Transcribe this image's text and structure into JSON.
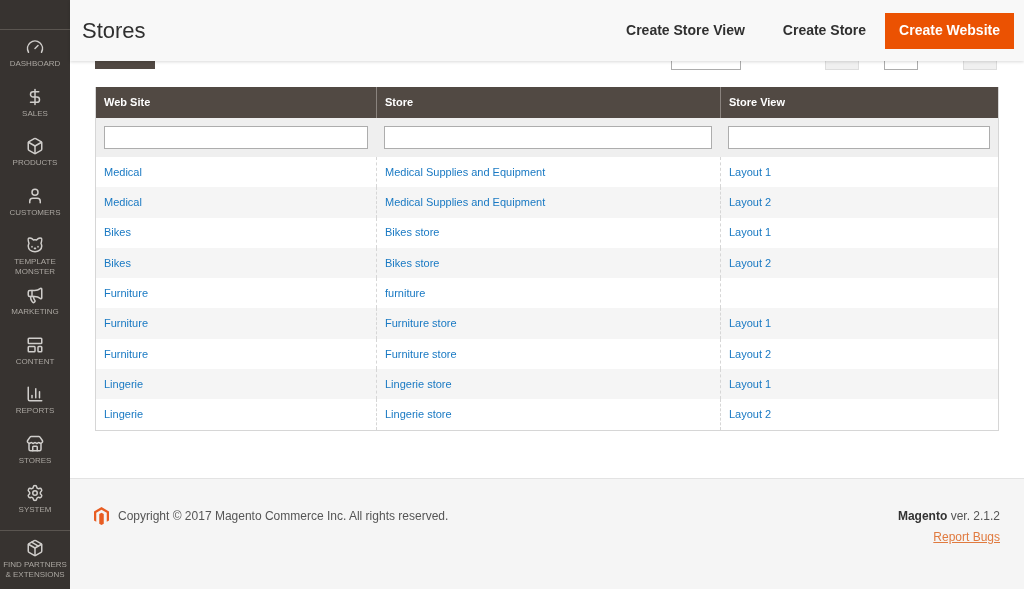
{
  "sidebar": {
    "items": [
      {
        "label": "DASHBOARD"
      },
      {
        "label": "SALES"
      },
      {
        "label": "PRODUCTS"
      },
      {
        "label": "CUSTOMERS"
      },
      {
        "label": "TEMPLATE MONSTER"
      },
      {
        "label": "MARKETING"
      },
      {
        "label": "CONTENT"
      },
      {
        "label": "REPORTS"
      },
      {
        "label": "STORES"
      },
      {
        "label": "SYSTEM"
      },
      {
        "label": "FIND PARTNERS & EXTENSIONS"
      }
    ]
  },
  "header": {
    "title": "Stores",
    "actions": [
      {
        "label": "Create Store View",
        "kind": "plain"
      },
      {
        "label": "Create Store",
        "kind": "plain"
      },
      {
        "label": "Create Website",
        "kind": "primary"
      }
    ]
  },
  "table": {
    "columns": [
      "Web Site",
      "Store",
      "Store View"
    ],
    "rows": [
      {
        "web_site": "Medical",
        "store": "Medical Supplies and Equipment",
        "store_view": "Layout 1"
      },
      {
        "web_site": "Medical",
        "store": "Medical Supplies and Equipment",
        "store_view": "Layout 2"
      },
      {
        "web_site": "Bikes",
        "store": "Bikes store",
        "store_view": "Layout 1"
      },
      {
        "web_site": "Bikes",
        "store": "Bikes store",
        "store_view": "Layout 2"
      },
      {
        "web_site": "Furniture",
        "store": "furniture"
      },
      {
        "web_site": "Furniture",
        "store": "Furniture store",
        "store_view": "Layout 1"
      },
      {
        "web_site": "Furniture",
        "store": "Furniture store",
        "store_view": "Layout 2"
      },
      {
        "web_site": "Lingerie",
        "store": "Lingerie store",
        "store_view": "Layout 1"
      },
      {
        "web_site": "Lingerie",
        "store": "Lingerie store",
        "store_view": "Layout 2"
      }
    ]
  },
  "footer": {
    "copyright": "Copyright © 2017 Magento Commerce Inc. All rights reserved.",
    "brand": "Magento",
    "version": "ver. 2.1.2",
    "link": "Report Bugs"
  }
}
